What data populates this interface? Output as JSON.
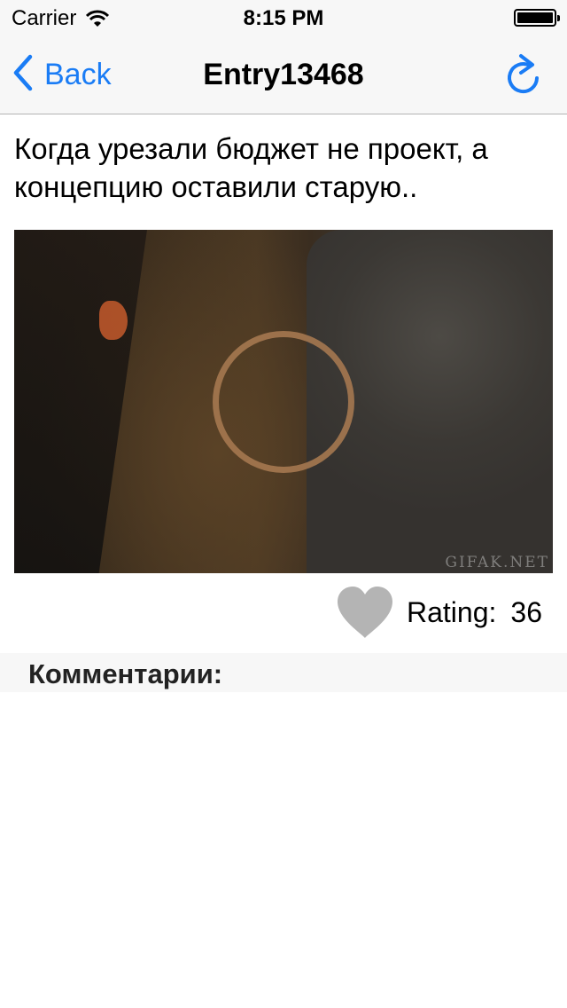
{
  "status_bar": {
    "carrier": "Carrier",
    "time": "8:15 PM",
    "battery_level": 1.0
  },
  "nav": {
    "back_label": "Back",
    "title": "Entry13468",
    "back_icon": "chevron-left-icon",
    "refresh_icon": "refresh-icon",
    "tint_color": "#1a7cf5"
  },
  "entry": {
    "text": "Когда урезали бюджет не проект, а концепцию оставили старую..",
    "media": {
      "watermark": "GIFAK.NET",
      "loading_icon": "loading-ring-icon"
    },
    "like_icon": "heart-icon",
    "like_color": "#b4b4b4",
    "rating_label": "Rating:",
    "rating_value": "36"
  },
  "comments": {
    "title": "Комментарии:"
  }
}
